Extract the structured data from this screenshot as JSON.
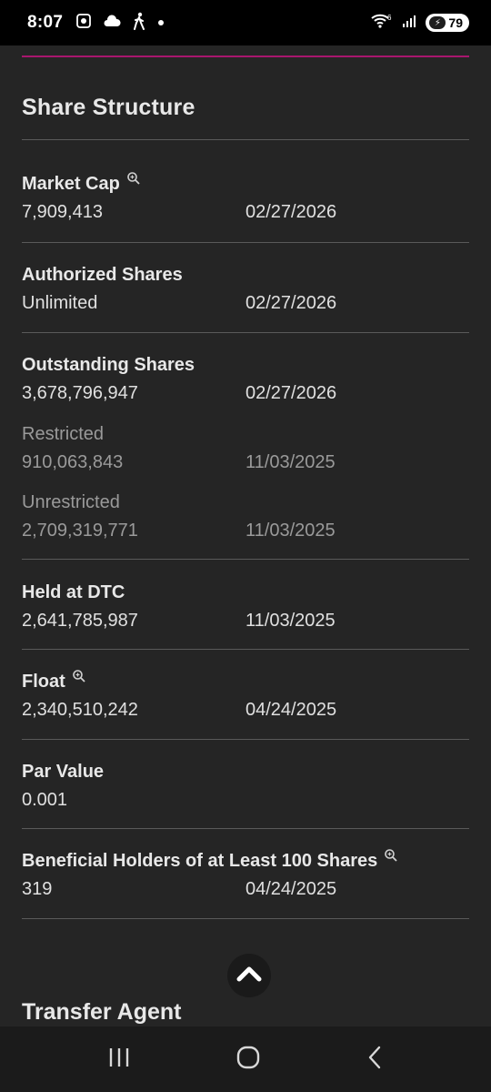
{
  "status": {
    "time": "8:07",
    "battery": "79",
    "network_superscript": "6"
  },
  "section_title": "Share Structure",
  "rows": [
    {
      "label": "Market Cap",
      "value": "7,909,413",
      "date": "02/27/2026",
      "has_zoom": true
    },
    {
      "label": "Authorized Shares",
      "value": "Unlimited",
      "date": "02/27/2026"
    },
    {
      "label": "Outstanding Shares",
      "value": "3,678,796,947",
      "date": "02/27/2026"
    },
    {
      "label": "Restricted",
      "value": "910,063,843",
      "date": "11/03/2025"
    },
    {
      "label": "Unrestricted",
      "value": "2,709,319,771",
      "date": "11/03/2025"
    },
    {
      "label": "Held at DTC",
      "value": "2,641,785,987",
      "date": "11/03/2025"
    },
    {
      "label": "Float",
      "value": "2,340,510,242",
      "date": "04/24/2025",
      "has_zoom": true
    },
    {
      "label": "Par Value",
      "value": "0.001",
      "date": ""
    },
    {
      "label": "Beneficial Holders of at Least 100 Shares",
      "value": "319",
      "date": "04/24/2025",
      "has_zoom": true
    }
  ],
  "next_section_title": "Transfer Agent",
  "icons": {
    "screenshot": "screenshot-icon",
    "cloud": "cloud-icon",
    "walking": "walking-icon",
    "wifi": "wifi-icon",
    "signal": "signal-icon",
    "zoom": "zoom-icon",
    "scroll_top": "chevron-up-icon",
    "recents": "recents-icon",
    "home": "home-icon",
    "back": "back-icon"
  },
  "colors": {
    "background": "#252525",
    "accent": "#a8166e",
    "divider": "#5a5a5a",
    "muted_text": "#9a9a9a"
  }
}
